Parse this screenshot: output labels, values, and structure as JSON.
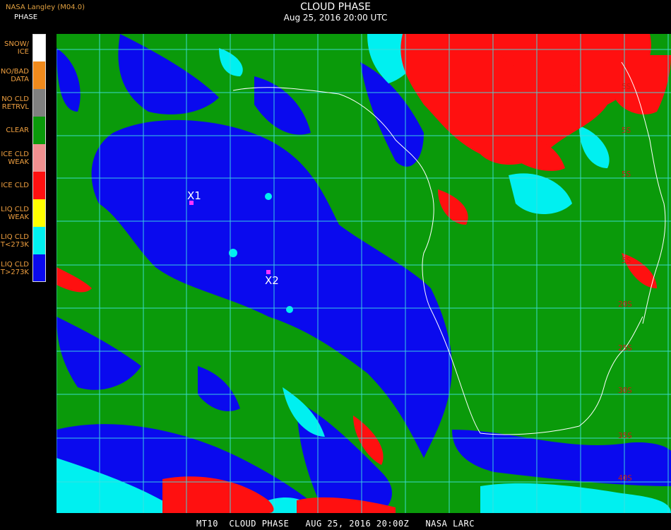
{
  "header": {
    "source": "NASA Langley (M04.0)",
    "product": "PHASE",
    "title": "CLOUD PHASE",
    "subtitle": "Aug 25, 2016 20:00 UTC"
  },
  "legend": [
    {
      "lines": [
        "SNOW/",
        "ICE"
      ],
      "color": "#ffffff"
    },
    {
      "lines": [
        "NO/BAD",
        "DATA"
      ],
      "color": "#f08a1c"
    },
    {
      "lines": [
        "NO CLD",
        "RETRVL"
      ],
      "color": "#808080"
    },
    {
      "lines": [
        "CLEAR"
      ],
      "color": "#0a9a0a"
    },
    {
      "lines": [
        "ICE CLD",
        "WEAK"
      ],
      "color": "#f09090"
    },
    {
      "lines": [
        "ICE CLD"
      ],
      "color": "#ff1010"
    },
    {
      "lines": [
        "LIQ CLD",
        "WEAK"
      ],
      "color": "#ffff00"
    },
    {
      "lines": [
        "LIQ CLD",
        "T<273K"
      ],
      "color": "#00f0f0"
    },
    {
      "lines": [
        "LIQ CLD",
        "T>273K"
      ],
      "color": "#0a0aee"
    }
  ],
  "markers": [
    {
      "label": "X1",
      "color": "#ff33ff"
    },
    {
      "label": "X2",
      "color": "#ff33ff"
    }
  ],
  "lat_labels": [
    "5S",
    "5S",
    "5S",
    "5S",
    "20S",
    "25S",
    "30S",
    "35S",
    "40S"
  ],
  "footer": "MT10  CLOUD PHASE   AUG 25, 2016 20:00Z   NASA LARC",
  "colors": {
    "grid": "#40e0e0",
    "coastline": "#ffffff",
    "lat_label": "#cc1a10"
  }
}
